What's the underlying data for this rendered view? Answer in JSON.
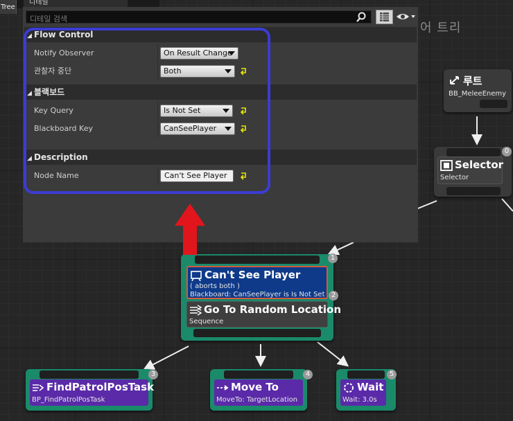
{
  "colors": {
    "graph_bg": "#262626",
    "node_green": "#1a8a6a",
    "decorator_blue": "#0f3a8a",
    "task_purple": "#5a2aa8",
    "highlight_blue": "#3c3cd6",
    "arrow_red": "#e0161c"
  },
  "tabs": {
    "tree_tab": "Tree",
    "details_tab": "디테일"
  },
  "graph_title": "어 트리",
  "details": {
    "search_placeholder": "디테일 검색",
    "icons": [
      "search-icon",
      "grid-view-icon",
      "eye-icon"
    ],
    "categories": [
      {
        "label": "Flow Control",
        "rows": [
          {
            "name": "Notify Observer",
            "value": "On Result Change"
          },
          {
            "name": "관찰자 중단",
            "value": "Both"
          }
        ]
      },
      {
        "label": "블랙보드",
        "rows": [
          {
            "name": "Key Query",
            "value": "Is Not Set"
          },
          {
            "name": "Blackboard Key",
            "value": "CanSeePlayer"
          }
        ]
      },
      {
        "label": "Description",
        "rows": [
          {
            "name": "Node Name",
            "value": "Can't See Player"
          }
        ]
      }
    ]
  },
  "graph": {
    "root": {
      "title": "루트",
      "subtitle": "BB_MeleeEnemy"
    },
    "selector": {
      "title": "Selector",
      "subtitle": "Selector",
      "index": "0"
    },
    "sequence": {
      "index": "1",
      "decorator": {
        "title": "Can't See Player",
        "line1": "( aborts both )",
        "line2": "Blackboard: CanSeePlayer is Is Not Set",
        "index": "2"
      },
      "title": "Go To Random Location",
      "subtitle": "Sequence"
    },
    "tasks": [
      {
        "title": "FindPatrolPosTask",
        "subtitle": "BP_FindPatrolPosTask",
        "index": "3"
      },
      {
        "title": "Move To",
        "subtitle": "MoveTo: TargetLocation",
        "index": "4"
      },
      {
        "title": "Wait",
        "subtitle": "Wait: 3.0s",
        "index": "5"
      }
    ]
  }
}
